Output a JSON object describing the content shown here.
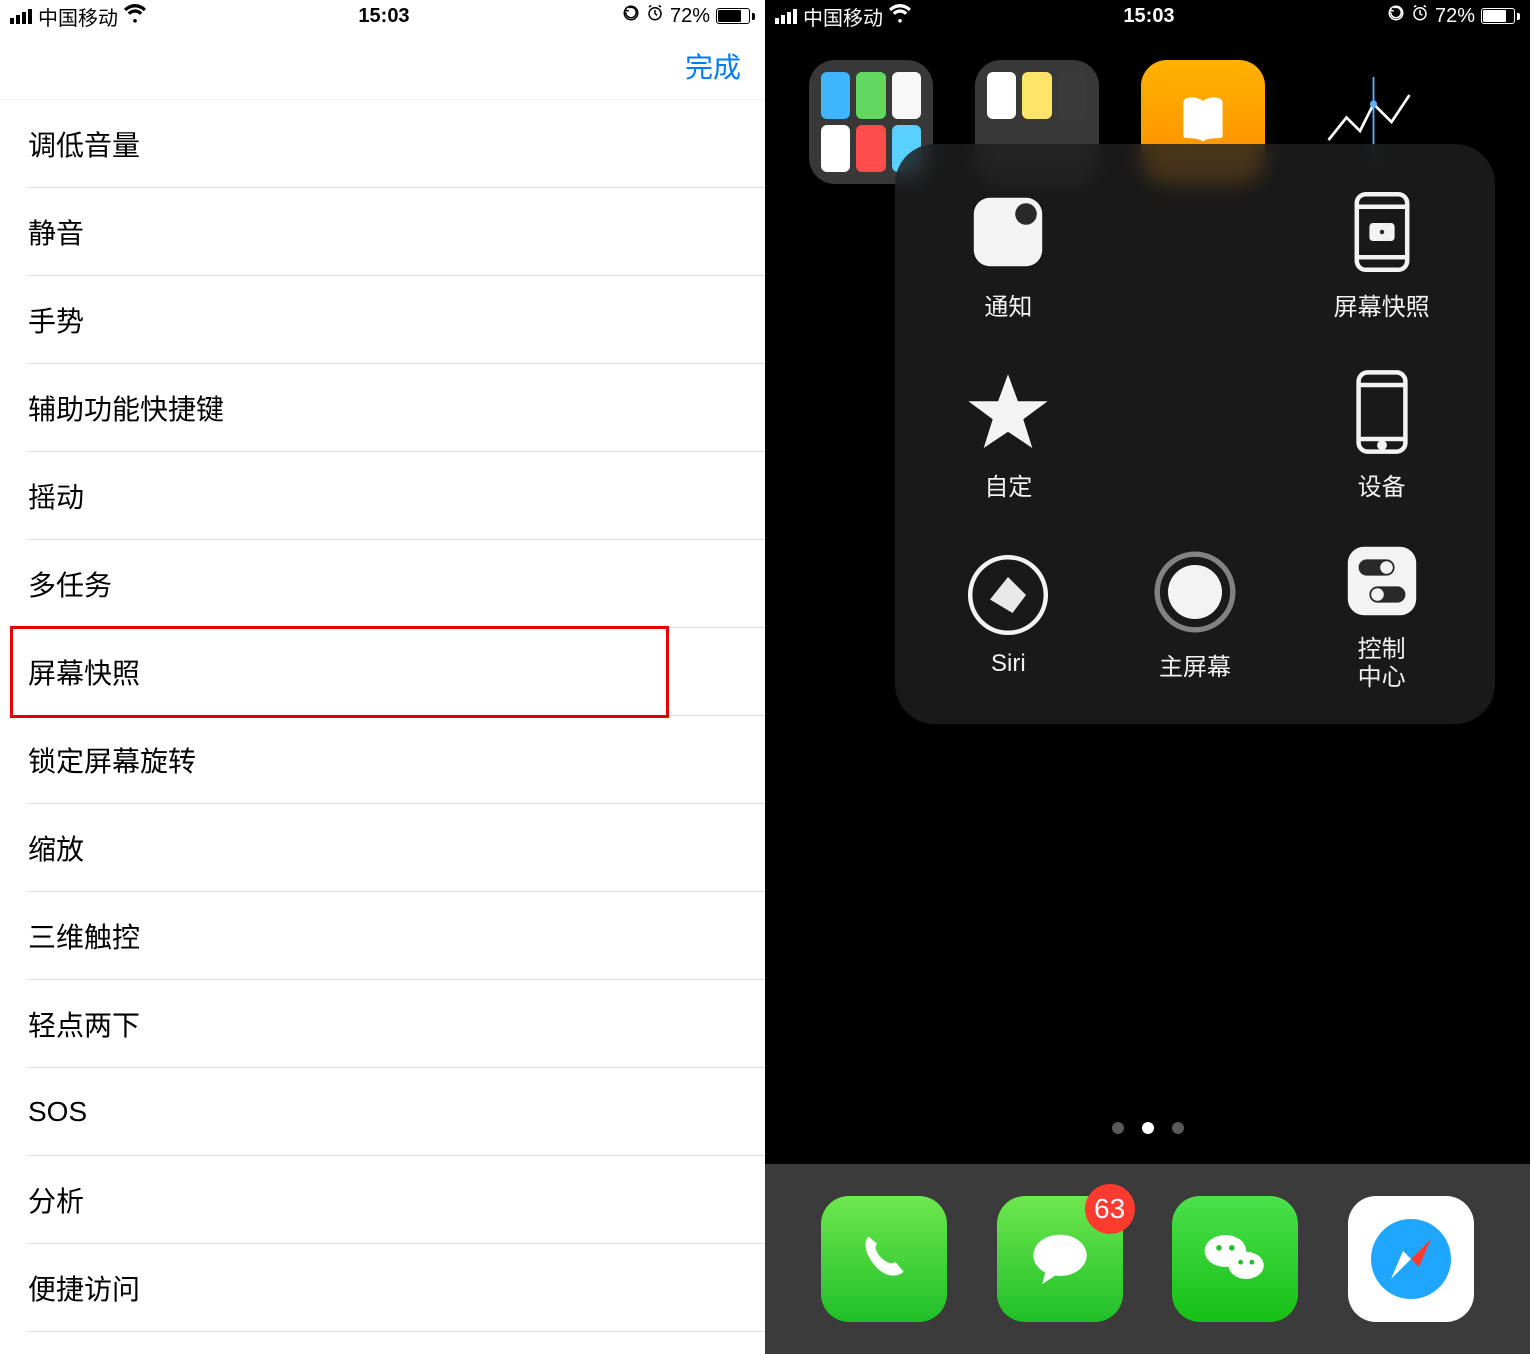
{
  "status": {
    "carrier": "中国移动",
    "time": "15:03",
    "battery_percent": "72%"
  },
  "left": {
    "done_label": "完成",
    "items": [
      {
        "label": "调低音量"
      },
      {
        "label": "静音"
      },
      {
        "label": "手势"
      },
      {
        "label": "辅助功能快捷键"
      },
      {
        "label": "摇动"
      },
      {
        "label": "多任务"
      },
      {
        "label": "屏幕快照",
        "highlighted": true
      },
      {
        "label": "锁定屏幕旋转"
      },
      {
        "label": "缩放"
      },
      {
        "label": "三维触控"
      },
      {
        "label": "轻点两下"
      },
      {
        "label": "SOS"
      },
      {
        "label": "分析"
      },
      {
        "label": "便捷访问"
      }
    ]
  },
  "right": {
    "assistive": {
      "notification": "通知",
      "screenshot": "屏幕快照",
      "custom": "自定",
      "device": "设备",
      "siri": "Siri",
      "home": "主屏幕",
      "control_center": "控制\n中心"
    },
    "dock": {
      "messages_badge": "63"
    },
    "page_dots": {
      "count": 3,
      "active_index": 1
    }
  }
}
